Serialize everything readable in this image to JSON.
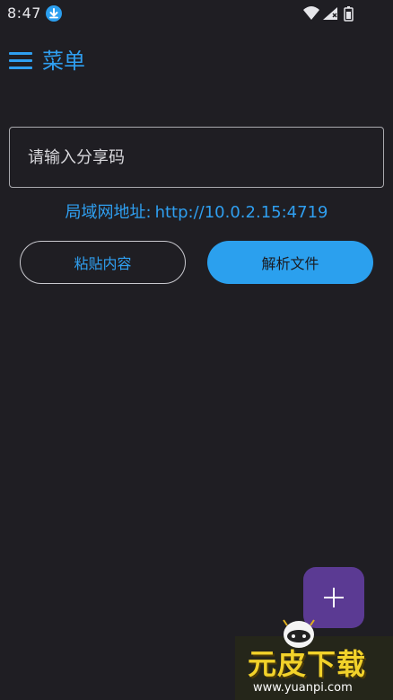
{
  "status_bar": {
    "time": "8:47",
    "download_icon": "download-circle-icon",
    "right_icons": [
      "wifi-icon",
      "signal-icon",
      "battery-icon"
    ]
  },
  "header": {
    "menu_icon": "hamburger-menu-icon",
    "title": "菜单"
  },
  "share_input": {
    "placeholder": "请输入分享码",
    "value": ""
  },
  "lan_address": {
    "label": "局域网地址:",
    "url": "http://10.0.2.15:4719"
  },
  "buttons": {
    "paste": "粘贴内容",
    "parse": "解析文件"
  },
  "fab": {
    "icon": "plus-icon"
  },
  "watermark": {
    "title": "元皮下载",
    "url": "www.yuanpi.com"
  },
  "colors": {
    "background": "#1f1e23",
    "accent": "#2f9ff0",
    "fab": "#5b3a93"
  }
}
